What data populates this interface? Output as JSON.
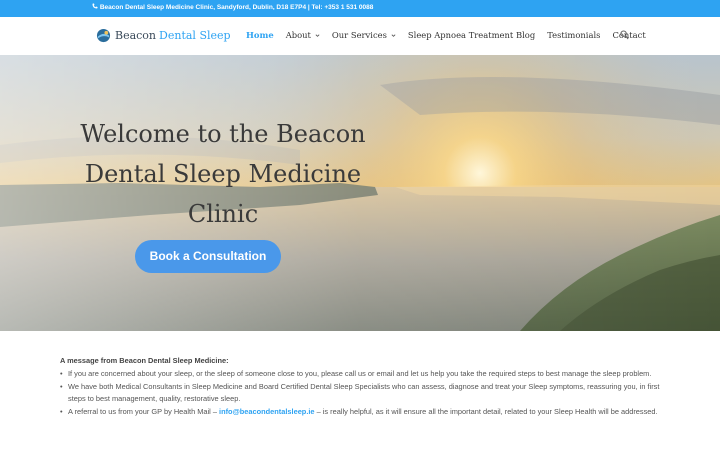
{
  "topbar": {
    "phone_icon": "phone-icon",
    "address_text": "Beacon Dental Sleep Medicine Clinic, Sandyford, Dublin, D18 E7P4 | Tel: +353 1 531 0088"
  },
  "header": {
    "logo_word1": "Beacon",
    "logo_word2": "Dental Sleep",
    "nav": {
      "home": "Home",
      "about": "About",
      "services": "Our Services",
      "blog": "Sleep Apnoea Treatment Blog",
      "testimonials": "Testimonials",
      "contact": "Contact"
    },
    "search_icon": "search-icon"
  },
  "hero": {
    "title": "Welcome to the Beacon Dental Sleep Medicine Clinic",
    "cta_label": "Book a Consultation"
  },
  "content": {
    "heading": "A message from Beacon Dental Sleep Medicine:",
    "bullets": [
      "If you are concerned about your sleep, or the sleep of someone close to you, please call us or email and let us help you take the required steps to best manage the sleep problem.",
      "We have both Medical Consultants in Sleep Medicine and Board Certified Dental Sleep Specialists who can assess, diagnose and treat your Sleep symptoms, reassuring you, in first steps to best management, quality, restorative sleep."
    ],
    "referral_prefix": "A referral to us from your GP by Health Mail – ",
    "referral_email": "info@beacondentalsleep.ie",
    "referral_suffix": " – is really helpful, as it will ensure all the important detail, related to your Sleep Health will be addressed."
  },
  "colors": {
    "accent": "#2ea3f2",
    "cta": "#4a98ea"
  }
}
